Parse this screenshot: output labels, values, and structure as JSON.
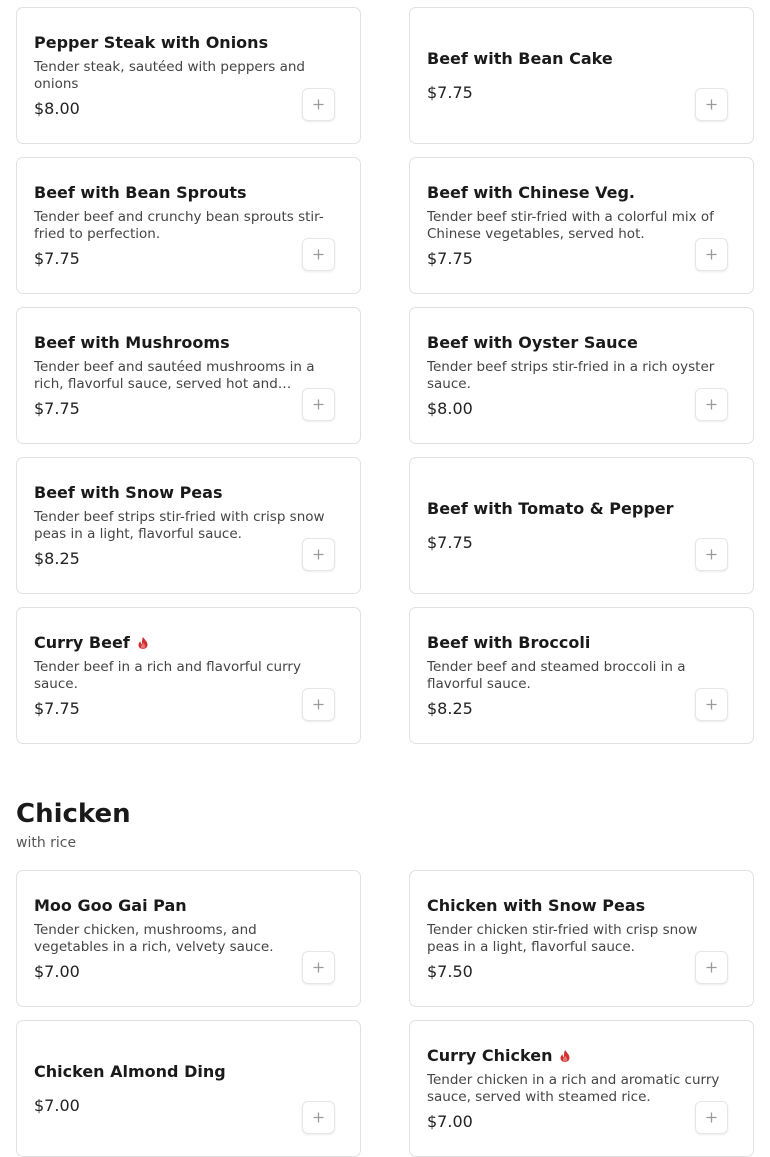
{
  "accent_color": "#d32f2f",
  "add_icon": "plus-icon",
  "spicy_icon": "flame-icon",
  "beef_items": [
    {
      "name": "Pepper Steak with Onions",
      "desc": "Tender steak, sautéed with peppers and onions",
      "price": "$8.00",
      "spicy": false
    },
    {
      "name": "Beef with Bean Cake",
      "desc": "",
      "price": "$7.75",
      "spicy": false
    },
    {
      "name": "Beef with Bean Sprouts",
      "desc": "Tender beef and crunchy bean sprouts stir-fried to perfection.",
      "price": "$7.75",
      "spicy": false
    },
    {
      "name": "Beef with Chinese Veg.",
      "desc": "Tender beef stir-fried with a colorful mix of Chinese vegetables, served hot.",
      "price": "$7.75",
      "spicy": false
    },
    {
      "name": "Beef with Mushrooms",
      "desc": "Tender beef and sautéed mushrooms in a rich, flavorful sauce, served hot and…",
      "price": "$7.75",
      "spicy": false
    },
    {
      "name": "Beef with Oyster Sauce",
      "desc": "Tender beef strips stir-fried in a rich oyster sauce.",
      "price": "$8.00",
      "spicy": false
    },
    {
      "name": "Beef with Snow Peas",
      "desc": "Tender beef strips stir-fried with crisp snow peas in a light, flavorful sauce.",
      "price": "$8.25",
      "spicy": false
    },
    {
      "name": "Beef with Tomato & Pepper",
      "desc": "",
      "price": "$7.75",
      "spicy": false
    },
    {
      "name": "Curry Beef",
      "desc": "Tender beef in a rich and flavorful curry sauce.",
      "price": "$7.75",
      "spicy": true
    },
    {
      "name": "Beef with Broccoli",
      "desc": "Tender beef and steamed broccoli in a flavorful sauce.",
      "price": "$8.25",
      "spicy": false
    }
  ],
  "chicken_section": {
    "title": "Chicken",
    "subtitle": "with rice",
    "items": [
      {
        "name": "Moo Goo Gai Pan",
        "desc": "Tender chicken, mushrooms, and vegetables in a rich, velvety sauce.",
        "price": "$7.00",
        "spicy": false
      },
      {
        "name": "Chicken with Snow Peas",
        "desc": "Tender chicken stir-fried with crisp snow peas in a light, flavorful sauce.",
        "price": "$7.50",
        "spicy": false
      },
      {
        "name": "Chicken Almond Ding",
        "desc": "",
        "price": "$7.00",
        "spicy": false
      },
      {
        "name": "Curry Chicken",
        "desc": "Tender chicken in a rich and aromatic curry sauce, served with steamed rice.",
        "price": "$7.00",
        "spicy": true
      }
    ]
  }
}
